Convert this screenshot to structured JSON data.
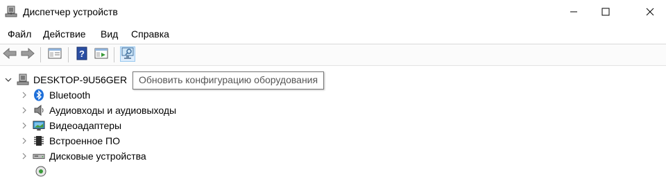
{
  "window": {
    "title": "Диспетчер устройств"
  },
  "menu": [
    "Файл",
    "Действие",
    "Вид",
    "Справка"
  ],
  "toolbar": {
    "buttons": [
      "back-icon",
      "forward-icon",
      "properties-icon",
      "help-icon",
      "run-icon",
      "scan-hardware-icon"
    ]
  },
  "tree": {
    "root": "DESKTOP-9U56GER",
    "nodes": [
      {
        "label": "Bluetooth",
        "icon": "bluetooth-icon"
      },
      {
        "label": "Аудиовходы и аудиовыходы",
        "icon": "speaker-icon"
      },
      {
        "label": "Видеоадаптеры",
        "icon": "monitor-icon"
      },
      {
        "label": "Встроенное ПО",
        "icon": "chip-icon"
      },
      {
        "label": "Дисковые устройства",
        "icon": "disk-icon"
      }
    ]
  },
  "tooltip": "Обновить конфигурацию оборудования",
  "colors": {
    "bluetooth": "#1e6fd9",
    "tooltip_border": "#767676",
    "toolbar_active": "#dcecfc"
  }
}
